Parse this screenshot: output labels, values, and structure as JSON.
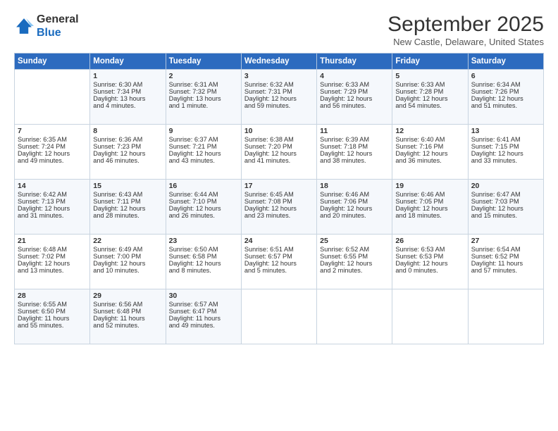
{
  "header": {
    "logo_line1": "General",
    "logo_line2": "Blue",
    "month": "September 2025",
    "location": "New Castle, Delaware, United States"
  },
  "days_of_week": [
    "Sunday",
    "Monday",
    "Tuesday",
    "Wednesday",
    "Thursday",
    "Friday",
    "Saturday"
  ],
  "weeks": [
    [
      {
        "day": "",
        "content": ""
      },
      {
        "day": "1",
        "content": "Sunrise: 6:30 AM\nSunset: 7:34 PM\nDaylight: 13 hours\nand 4 minutes."
      },
      {
        "day": "2",
        "content": "Sunrise: 6:31 AM\nSunset: 7:32 PM\nDaylight: 13 hours\nand 1 minute."
      },
      {
        "day": "3",
        "content": "Sunrise: 6:32 AM\nSunset: 7:31 PM\nDaylight: 12 hours\nand 59 minutes."
      },
      {
        "day": "4",
        "content": "Sunrise: 6:33 AM\nSunset: 7:29 PM\nDaylight: 12 hours\nand 56 minutes."
      },
      {
        "day": "5",
        "content": "Sunrise: 6:33 AM\nSunset: 7:28 PM\nDaylight: 12 hours\nand 54 minutes."
      },
      {
        "day": "6",
        "content": "Sunrise: 6:34 AM\nSunset: 7:26 PM\nDaylight: 12 hours\nand 51 minutes."
      }
    ],
    [
      {
        "day": "7",
        "content": "Sunrise: 6:35 AM\nSunset: 7:24 PM\nDaylight: 12 hours\nand 49 minutes."
      },
      {
        "day": "8",
        "content": "Sunrise: 6:36 AM\nSunset: 7:23 PM\nDaylight: 12 hours\nand 46 minutes."
      },
      {
        "day": "9",
        "content": "Sunrise: 6:37 AM\nSunset: 7:21 PM\nDaylight: 12 hours\nand 43 minutes."
      },
      {
        "day": "10",
        "content": "Sunrise: 6:38 AM\nSunset: 7:20 PM\nDaylight: 12 hours\nand 41 minutes."
      },
      {
        "day": "11",
        "content": "Sunrise: 6:39 AM\nSunset: 7:18 PM\nDaylight: 12 hours\nand 38 minutes."
      },
      {
        "day": "12",
        "content": "Sunrise: 6:40 AM\nSunset: 7:16 PM\nDaylight: 12 hours\nand 36 minutes."
      },
      {
        "day": "13",
        "content": "Sunrise: 6:41 AM\nSunset: 7:15 PM\nDaylight: 12 hours\nand 33 minutes."
      }
    ],
    [
      {
        "day": "14",
        "content": "Sunrise: 6:42 AM\nSunset: 7:13 PM\nDaylight: 12 hours\nand 31 minutes."
      },
      {
        "day": "15",
        "content": "Sunrise: 6:43 AM\nSunset: 7:11 PM\nDaylight: 12 hours\nand 28 minutes."
      },
      {
        "day": "16",
        "content": "Sunrise: 6:44 AM\nSunset: 7:10 PM\nDaylight: 12 hours\nand 26 minutes."
      },
      {
        "day": "17",
        "content": "Sunrise: 6:45 AM\nSunset: 7:08 PM\nDaylight: 12 hours\nand 23 minutes."
      },
      {
        "day": "18",
        "content": "Sunrise: 6:46 AM\nSunset: 7:06 PM\nDaylight: 12 hours\nand 20 minutes."
      },
      {
        "day": "19",
        "content": "Sunrise: 6:46 AM\nSunset: 7:05 PM\nDaylight: 12 hours\nand 18 minutes."
      },
      {
        "day": "20",
        "content": "Sunrise: 6:47 AM\nSunset: 7:03 PM\nDaylight: 12 hours\nand 15 minutes."
      }
    ],
    [
      {
        "day": "21",
        "content": "Sunrise: 6:48 AM\nSunset: 7:02 PM\nDaylight: 12 hours\nand 13 minutes."
      },
      {
        "day": "22",
        "content": "Sunrise: 6:49 AM\nSunset: 7:00 PM\nDaylight: 12 hours\nand 10 minutes."
      },
      {
        "day": "23",
        "content": "Sunrise: 6:50 AM\nSunset: 6:58 PM\nDaylight: 12 hours\nand 8 minutes."
      },
      {
        "day": "24",
        "content": "Sunrise: 6:51 AM\nSunset: 6:57 PM\nDaylight: 12 hours\nand 5 minutes."
      },
      {
        "day": "25",
        "content": "Sunrise: 6:52 AM\nSunset: 6:55 PM\nDaylight: 12 hours\nand 2 minutes."
      },
      {
        "day": "26",
        "content": "Sunrise: 6:53 AM\nSunset: 6:53 PM\nDaylight: 12 hours\nand 0 minutes."
      },
      {
        "day": "27",
        "content": "Sunrise: 6:54 AM\nSunset: 6:52 PM\nDaylight: 11 hours\nand 57 minutes."
      }
    ],
    [
      {
        "day": "28",
        "content": "Sunrise: 6:55 AM\nSunset: 6:50 PM\nDaylight: 11 hours\nand 55 minutes."
      },
      {
        "day": "29",
        "content": "Sunrise: 6:56 AM\nSunset: 6:48 PM\nDaylight: 11 hours\nand 52 minutes."
      },
      {
        "day": "30",
        "content": "Sunrise: 6:57 AM\nSunset: 6:47 PM\nDaylight: 11 hours\nand 49 minutes."
      },
      {
        "day": "",
        "content": ""
      },
      {
        "day": "",
        "content": ""
      },
      {
        "day": "",
        "content": ""
      },
      {
        "day": "",
        "content": ""
      }
    ]
  ]
}
